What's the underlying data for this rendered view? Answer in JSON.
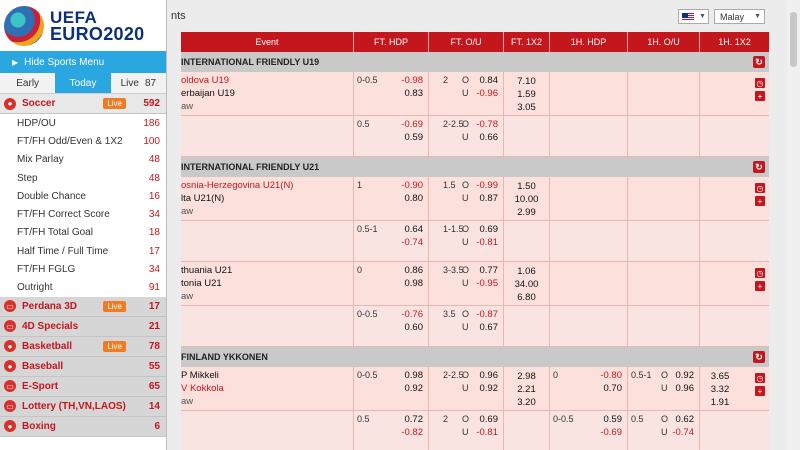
{
  "logo": {
    "line1": "UEFA",
    "line2": "EURO2020"
  },
  "sidebar": {
    "hide_menu": "Hide Sports Menu",
    "tabs": [
      {
        "label": "Early",
        "active": false
      },
      {
        "label": "Today",
        "active": true
      },
      {
        "label": "Live",
        "count": "87",
        "active": false
      }
    ],
    "current_sport": {
      "name": "Soccer",
      "live": "Live",
      "count": "592"
    },
    "sub_items": [
      {
        "name": "HDP/OU",
        "count": "186"
      },
      {
        "name": "FT/FH Odd/Even & 1X2",
        "count": "100"
      },
      {
        "name": "Mix Parlay",
        "count": "48"
      },
      {
        "name": "Step",
        "count": "48"
      },
      {
        "name": "Double Chance",
        "count": "16"
      },
      {
        "name": "FT/FH Correct Score",
        "count": "34"
      },
      {
        "name": "FT/FH Total Goal",
        "count": "18"
      },
      {
        "name": "Half Time / Full Time",
        "count": "17"
      },
      {
        "name": "FT/FH FGLG",
        "count": "34"
      },
      {
        "name": "Outright",
        "count": "91"
      }
    ],
    "sports": [
      {
        "name": "Perdana 3D",
        "live": "Live",
        "count": "17"
      },
      {
        "name": "4D Specials",
        "live": "",
        "count": "21"
      },
      {
        "name": "Basketball",
        "live": "Live",
        "count": "78"
      },
      {
        "name": "Baseball",
        "live": "",
        "count": "55"
      },
      {
        "name": "E-Sport",
        "live": "",
        "count": "65"
      },
      {
        "name": "Lottery (TH,VN,LAOS)",
        "live": "",
        "count": "14"
      },
      {
        "name": "Boxing",
        "live": "",
        "count": "6"
      }
    ]
  },
  "topbar": {
    "title": "nts",
    "language": "Malay"
  },
  "table": {
    "headers": [
      "Event",
      "FT. HDP",
      "FT. O/U",
      "FT. 1X2",
      "1H. HDP",
      "1H. O/U",
      "1H. 1X2"
    ]
  },
  "leagues": [
    {
      "name": "INTERNATIONAL FRIENDLY U19",
      "matches": [
        {
          "home": "oldova U19",
          "away": "erbaijan U19",
          "draw": "aw",
          "home_red": true,
          "away_red": false,
          "rows": [
            {
              "hdp_line": "0-0.5",
              "hdp_h": "-0.98",
              "hdp_a": "0.83",
              "ou_line": "2",
              "ou_o": "0.84",
              "ou_u": "-0.96",
              "x1": "7.10",
              "x2": "1.59",
              "x3": "3.05"
            },
            {
              "hdp_line": "0.5",
              "hdp_h": "-0.69",
              "hdp_a": "0.59",
              "ou_line": "2-2.5",
              "ou_o": "-0.78",
              "ou_u": "0.66"
            }
          ]
        }
      ]
    },
    {
      "name": "INTERNATIONAL FRIENDLY U21",
      "matches": [
        {
          "home": "osnia-Herzegovina U21(N)",
          "away": "lta U21(N)",
          "draw": "aw",
          "home_red": true,
          "away_red": false,
          "rows": [
            {
              "hdp_line": "1",
              "hdp_h": "-0.90",
              "hdp_a": "0.80",
              "ou_line": "1.5",
              "ou_o": "-0.99",
              "ou_u": "0.87",
              "x1": "1.50",
              "x2": "10.00",
              "x3": "2.99"
            },
            {
              "hdp_line": "0.5-1",
              "hdp_h": "0.64",
              "hdp_a": "-0.74",
              "ou_line": "1-1.5",
              "ou_o": "0.69",
              "ou_u": "-0.81"
            }
          ]
        },
        {
          "home": "thuania U21",
          "away": "tonia U21",
          "draw": "aw",
          "home_red": false,
          "away_red": false,
          "rows": [
            {
              "hdp_line": "0",
              "hdp_h": "0.86",
              "hdp_a": "0.98",
              "ou_line": "3-3.5",
              "ou_o": "0.77",
              "ou_u": "-0.95",
              "x1": "1.06",
              "x2": "34.00",
              "x3": "6.80"
            },
            {
              "hdp_line": "0-0.5",
              "hdp_h": "-0.76",
              "hdp_a": "0.60",
              "ou_line": "3.5",
              "ou_o": "-0.87",
              "ou_u": "0.67"
            }
          ]
        }
      ]
    },
    {
      "name": "FINLAND YKKONEN",
      "matches": [
        {
          "home": "P Mikkeli",
          "away": "V Kokkola",
          "draw": "aw",
          "home_red": false,
          "away_red": true,
          "rows": [
            {
              "hdp_line": "0-0.5",
              "hdp_h": "0.98",
              "hdp_a": "0.92",
              "ou_line": "2-2.5",
              "ou_o": "0.96",
              "ou_u": "0.92",
              "x1": "2.98",
              "x2": "2.21",
              "x3": "3.20",
              "h_hdp_line": "0",
              "h_hdp_h": "-0.80",
              "h_hdp_a": "0.70",
              "h_ou_line": "0.5-1",
              "h_ou_o": "0.92",
              "h_ou_u": "0.96",
              "h_x1": "3.65",
              "h_x2": "3.32",
              "h_x3": "1.91"
            },
            {
              "hdp_line": "0.5",
              "hdp_h": "0.72",
              "hdp_a": "-0.82",
              "ou_line": "2",
              "ou_o": "0.69",
              "ou_u": "-0.81",
              "h_hdp_line": "0-0.5",
              "h_hdp_h": "0.59",
              "h_hdp_a": "-0.69",
              "h_ou_line": "0.5",
              "h_ou_o": "0.62",
              "h_ou_u": "-0.74"
            }
          ]
        }
      ]
    }
  ],
  "labels": {
    "over": "O",
    "under": "U"
  }
}
